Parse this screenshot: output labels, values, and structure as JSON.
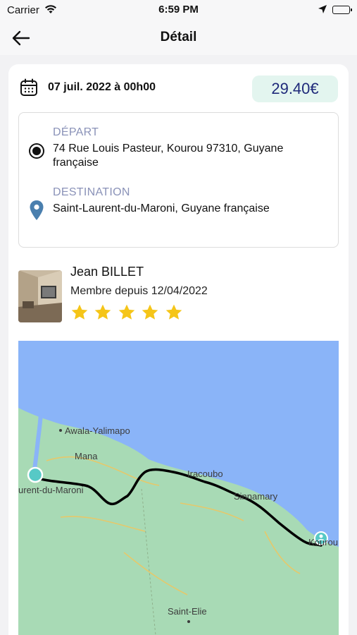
{
  "status_bar": {
    "carrier": "Carrier",
    "time": "6:59 PM"
  },
  "nav": {
    "title": "Détail"
  },
  "trip": {
    "date": "07 juil. 2022 à 00h00",
    "price": "29.40€",
    "depart_label": "DÉPART",
    "depart_address": "74 Rue Louis Pasteur, Kourou 97310, Guyane française",
    "destination_label": "DESTINATION",
    "destination_address": "Saint-Laurent-du-Maroni, Guyane française"
  },
  "driver": {
    "name": "Jean BILLET",
    "member_since": "Membre depuis 12/04/2022",
    "rating": 5,
    "rating_max": 5
  },
  "map": {
    "places": [
      "Awala-Yalimapo",
      "Mana",
      "urent-du-Maroni",
      "Iracoubo",
      "Sinnamary",
      "Kourou",
      "Saint-Elie"
    ],
    "colors": {
      "sea": "#8ab4f8",
      "land": "#a8dab5",
      "route": "#000000",
      "marker": "#57c9c6"
    }
  },
  "colors": {
    "price_bg": "#e3f5ef",
    "price_text": "#1f2a7a",
    "label": "#8a92b8",
    "star": "#f5c518",
    "destination_pin": "#4a7fae"
  }
}
